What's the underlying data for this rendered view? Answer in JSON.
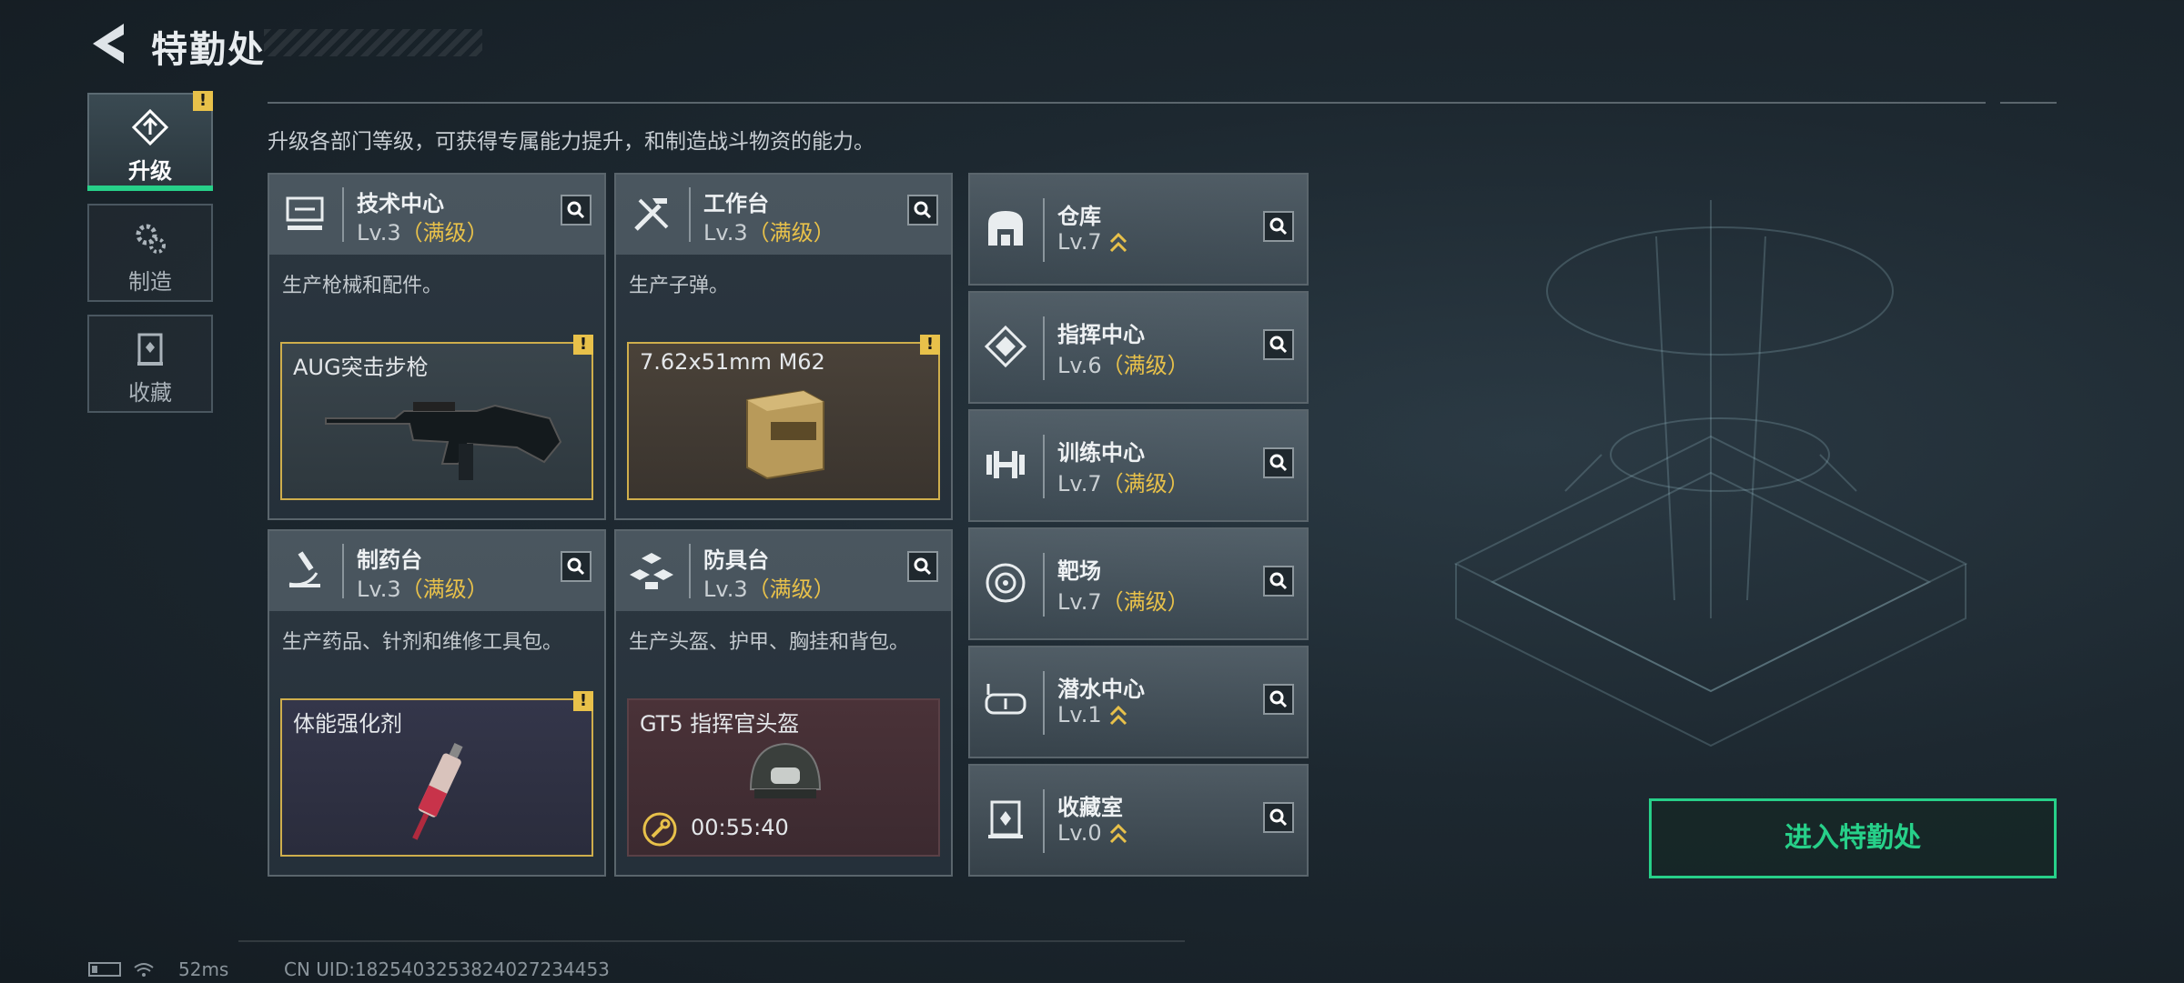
{
  "header": {
    "title": "特勤处"
  },
  "nav": [
    {
      "label": "升级"
    },
    {
      "label": "制造"
    },
    {
      "label": "收藏"
    }
  ],
  "description": "升级各部门等级，可获得专属能力提升，和制造战斗物资的能力。",
  "cards": [
    {
      "name": "技术中心",
      "level": "Lv.3",
      "max": "（满级）",
      "desc": "生产枪械和配件。",
      "item": "AUG突击步枪"
    },
    {
      "name": "工作台",
      "level": "Lv.3",
      "max": "（满级）",
      "desc": "生产子弹。",
      "item": "7.62x51mm M62"
    },
    {
      "name": "制药台",
      "level": "Lv.3",
      "max": "（满级）",
      "desc": "生产药品、针剂和维修工具包。",
      "item": "体能强化剂"
    },
    {
      "name": "防具台",
      "level": "Lv.3",
      "max": "（满级）",
      "desc": "生产头盔、护甲、胸挂和背包。",
      "item": "GT5 指挥官头盔",
      "timer": "00:55:40"
    }
  ],
  "rooms": [
    {
      "name": "仓库",
      "level": "Lv.7",
      "max": ""
    },
    {
      "name": "指挥中心",
      "level": "Lv.6",
      "max": "（满级）"
    },
    {
      "name": "训练中心",
      "level": "Lv.7",
      "max": "（满级）"
    },
    {
      "name": "靶场",
      "level": "Lv.7",
      "max": "（满级）"
    },
    {
      "name": "潜水中心",
      "level": "Lv.1",
      "max": ""
    },
    {
      "name": "收藏室",
      "level": "Lv.0",
      "max": ""
    }
  ],
  "enter_button": "进入特勤处",
  "status": {
    "ping": "52ms",
    "uid": "CN UID:1825403253824027234453"
  },
  "colors": {
    "accent": "#27d089",
    "gold": "#e8c14a"
  }
}
